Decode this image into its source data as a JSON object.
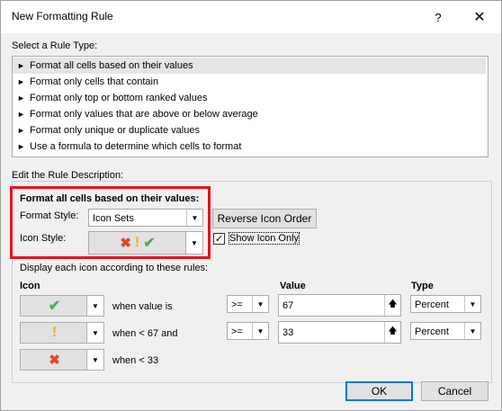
{
  "dialog": {
    "title": "New Formatting Rule",
    "help_glyph": "?",
    "close_glyph": "✕"
  },
  "rule_type": {
    "label": "Select a Rule Type:",
    "items": [
      "Format all cells based on their values",
      "Format only cells that contain",
      "Format only top or bottom ranked values",
      "Format only values that are above or below average",
      "Format only unique or duplicate values",
      "Use a formula to determine which cells to format"
    ],
    "selected_index": 0
  },
  "edit": {
    "label": "Edit the Rule Description:",
    "heading": "Format all cells based on their values:",
    "format_style_label": "Format Style:",
    "format_style_value": "Icon Sets",
    "icon_style_label": "Icon Style:",
    "reverse_button": "Reverse Icon Order",
    "show_icon_only_label": "Show Icon Only",
    "show_icon_only_checked": true,
    "display_rules_label": "Display each icon according to these rules:",
    "col_icon": "Icon",
    "col_value": "Value",
    "col_type": "Type",
    "rows": [
      {
        "icon": "green-check-icon",
        "text": "when value is",
        "operator": ">=",
        "value": "67",
        "type": "Percent"
      },
      {
        "icon": "yellow-exclamation-icon",
        "text": "when < 67 and",
        "operator": ">=",
        "value": "33",
        "type": "Percent"
      },
      {
        "icon": "red-x-icon",
        "text": "when < 33"
      }
    ]
  },
  "buttons": {
    "ok": "OK",
    "cancel": "Cancel"
  },
  "colors": {
    "highlight_border": "#e8121c",
    "red_icon": "#e0472c",
    "yellow_icon": "#f0b400",
    "green_icon": "#4caf50"
  }
}
